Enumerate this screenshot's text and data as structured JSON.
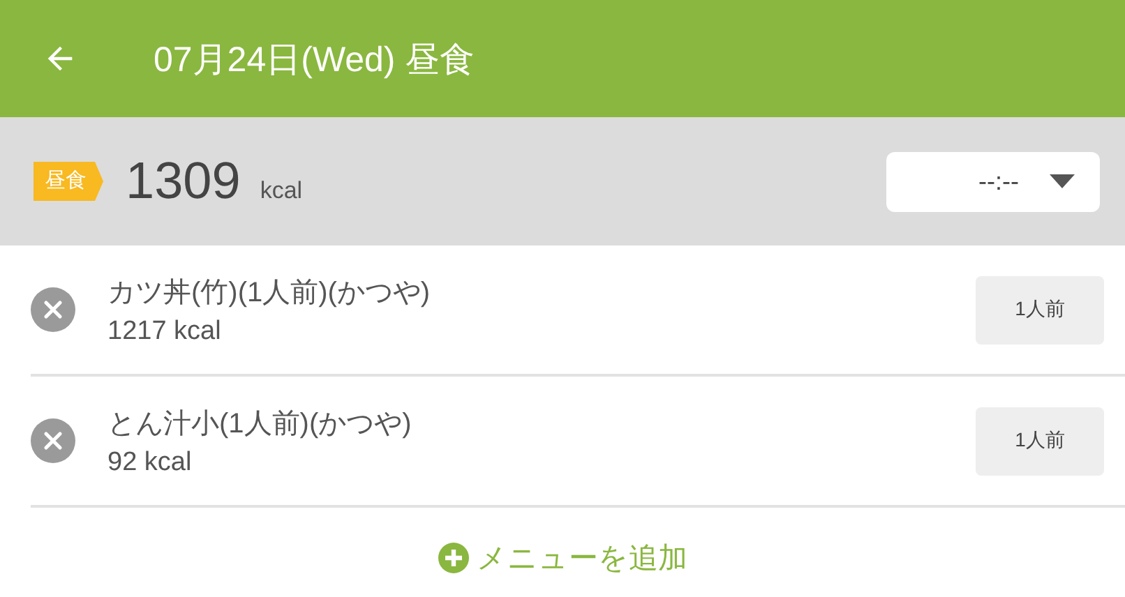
{
  "header": {
    "title": "07月24日(Wed) 昼食"
  },
  "summary": {
    "meal_tag": "昼食",
    "total": "1309",
    "unit": "kcal",
    "time": "--:--"
  },
  "items": [
    {
      "name": "カツ丼(竹)(1人前)(かつや)",
      "kcal": "1217 kcal",
      "portion": "1人前"
    },
    {
      "name": "とん汁小(1人前)(かつや)",
      "kcal": "92 kcal",
      "portion": "1人前"
    }
  ],
  "add_button": "メニューを追加"
}
